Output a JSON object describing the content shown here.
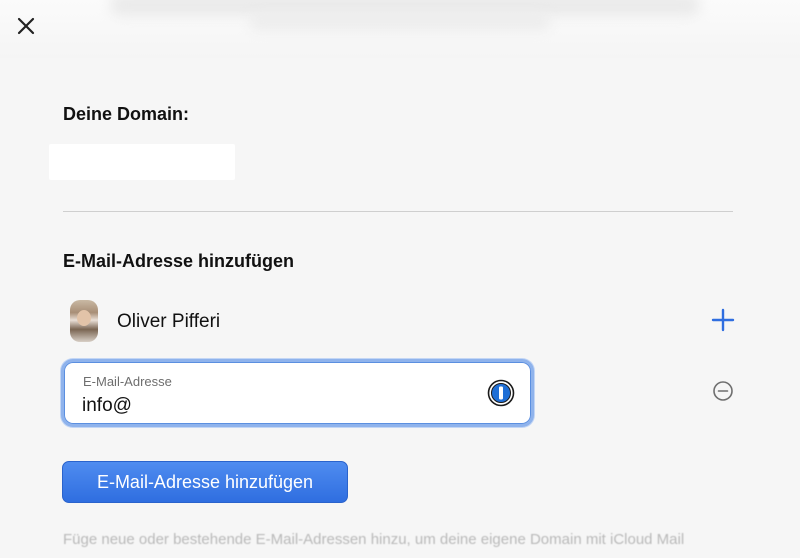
{
  "header": {
    "close_icon": "close-icon"
  },
  "domain": {
    "label": "Deine Domain:",
    "value": ""
  },
  "email_section": {
    "title": "E-Mail-Adresse hinzufügen",
    "user": {
      "name": "Oliver Pifferi",
      "avatar": "profile-photo",
      "add_icon": "plus-icon"
    },
    "field": {
      "label": "E-Mail-Adresse",
      "value": "info@",
      "password_manager_icon": "1password-icon",
      "remove_icon": "minus-circle-icon"
    },
    "submit_label": "E-Mail-Adresse hinzufügen"
  },
  "footer": {
    "text": "Füge neue oder bestehende E-Mail-Adressen hinzu, um deine eigene Domain mit iCloud Mail"
  },
  "colors": {
    "accent": "#3a78e6",
    "background": "#f6f6f6",
    "focus_ring": "#8fb3ec"
  }
}
